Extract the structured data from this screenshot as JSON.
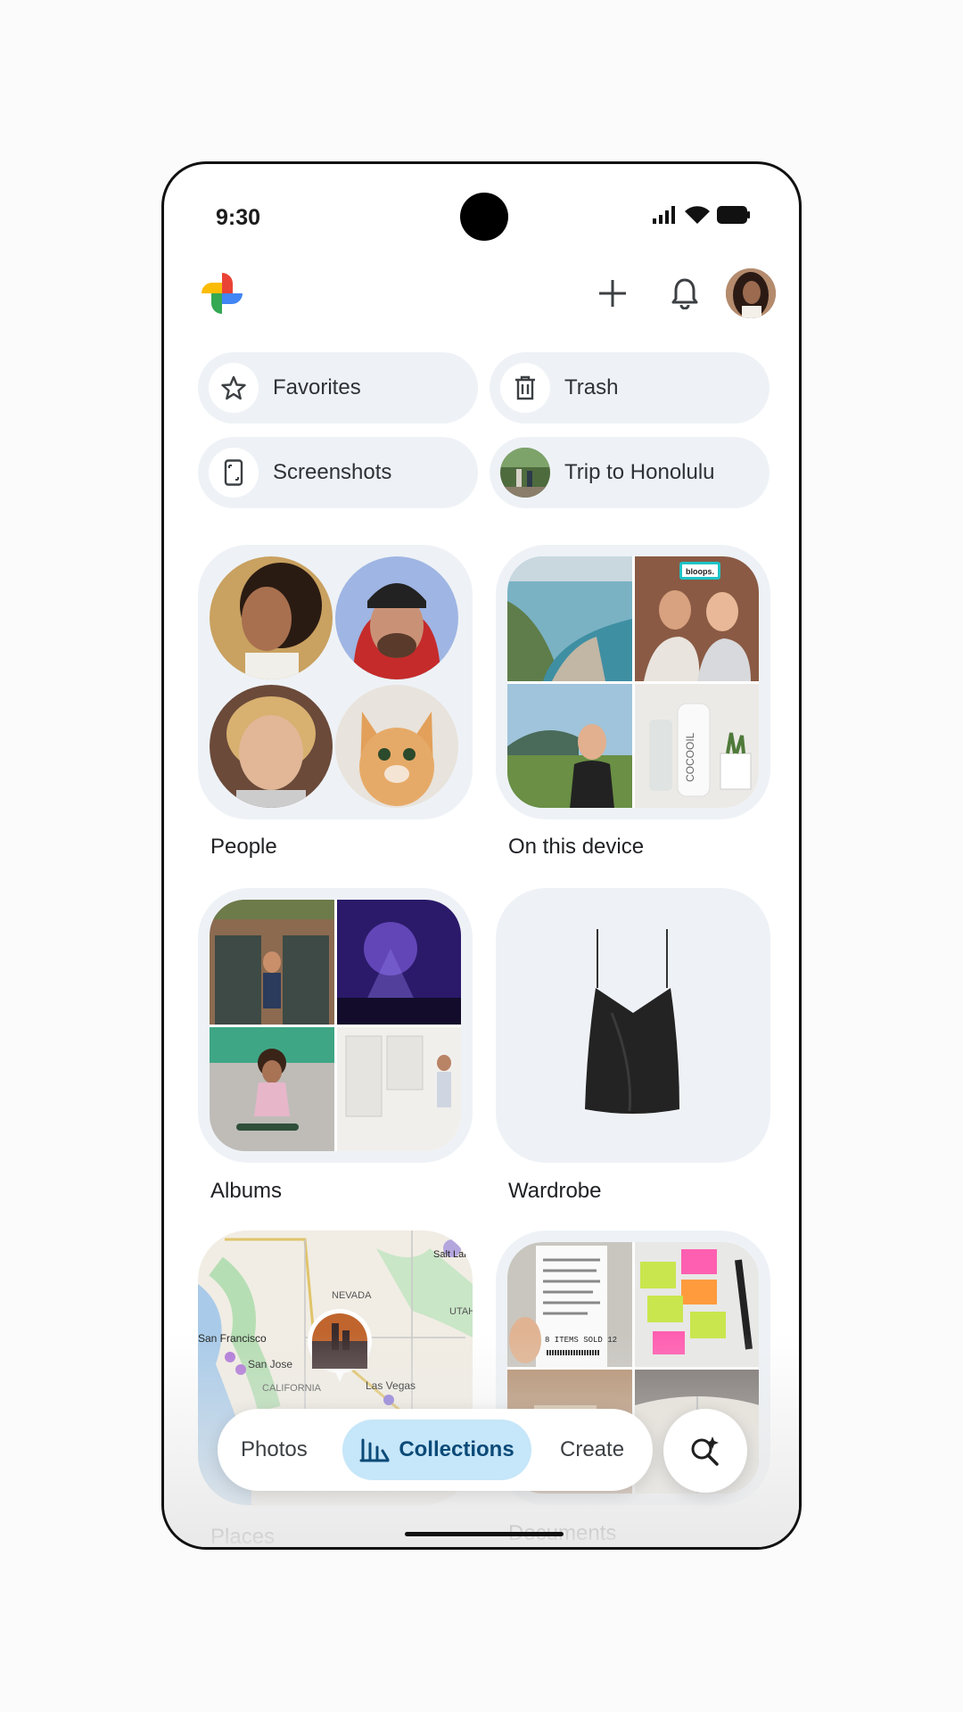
{
  "status": {
    "time": "9:30"
  },
  "header": {
    "logo": "google-photos-pinwheel",
    "actions": [
      "plus-icon",
      "bell-icon",
      "avatar"
    ]
  },
  "chips": [
    {
      "label": "Favorites",
      "icon": "star-icon"
    },
    {
      "label": "Trash",
      "icon": "trash-icon"
    },
    {
      "label": "Screenshots",
      "icon": "phone-screenshot-icon"
    },
    {
      "label": "Trip to Honolulu",
      "icon": "trip-thumbnail"
    }
  ],
  "collections": [
    {
      "label": "People"
    },
    {
      "label": "On this device"
    },
    {
      "label": "Albums"
    },
    {
      "label": "Wardrobe"
    },
    {
      "label": "Places"
    },
    {
      "label": "Documents"
    }
  ],
  "map": {
    "labels": [
      "NEVADA",
      "San Francisco",
      "San Jose",
      "CALIFORNIA",
      "Las Vegas",
      "Salt Lake",
      "UTAH"
    ]
  },
  "receipt_text": "8 ITEMS SOLD 12",
  "product_text": "COCOOIL",
  "sign_text": "bloops.",
  "nav": {
    "photos": "Photos",
    "collections": "Collections",
    "create": "Create"
  },
  "colors": {
    "accent": "#c6e6f9",
    "accent_text": "#0b4a78",
    "chip_bg": "#eef2f6"
  }
}
